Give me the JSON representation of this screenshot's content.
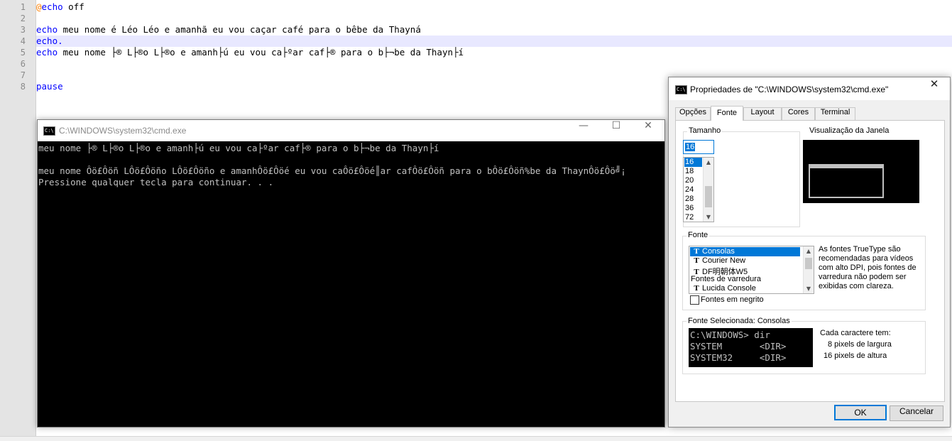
{
  "editor": {
    "line_numbers": [
      "1",
      "2",
      "3",
      "4",
      "5",
      "6",
      "7",
      "8"
    ],
    "line1": {
      "at": "@",
      "kw": "echo",
      "rest": " off"
    },
    "line3": {
      "kw": "echo",
      "rest": " meu nome é Léo Léo e amanhã eu vou caçar café para o bêbe da Thayná"
    },
    "line4": {
      "kw": "echo."
    },
    "line5": {
      "kw": "echo",
      "rest": " meu nome ├® L├®o L├®o e amanh├ú eu vou ca├ºar caf├® para o b├¬be da Thayn├í"
    },
    "line8": {
      "kw": "pause"
    },
    "colors": {
      "keyword": "#0000ff",
      "operator": "#ff8000",
      "current_line": "#e8e8ff"
    }
  },
  "cmd_window": {
    "title": "C:\\WINDOWS\\system32\\cmd.exe",
    "icon_text": "C:\\",
    "buttons": {
      "minimize": "—",
      "maximize": "☐",
      "close": "✕"
    },
    "output": [
      "meu nome ├® L├®o L├®o e amanh├ú eu vou ca├ºar caf├® para o b├¬be da Thayn├í",
      "",
      "meu nome Ôö£Ôöñ LÔö£Ôöño LÔö£Ôöño e amanhÔö£Ôöé eu vou caÔö£Ôöé║ar cafÔö£Ôöñ para o bÔö£Ôöñ%be da ThaynÔö£Ôö╝¡",
      "Pressione qualquer tecla para continuar. . ."
    ]
  },
  "dialog": {
    "title": "Propriedades de \"C:\\WINDOWS\\system32\\cmd.exe\"",
    "icon_text": "C:\\",
    "close": "✕",
    "tabs": [
      "Opções",
      "Fonte",
      "Layout",
      "Cores",
      "Terminal"
    ],
    "active_tab": "Fonte",
    "size_group_label": "Tamanho",
    "size_value": "16",
    "sizes": [
      "16",
      "18",
      "20",
      "24",
      "28",
      "36",
      "72"
    ],
    "selected_size": "16",
    "preview_label": "Visualização da Janela",
    "font_group_label": "Fonte",
    "fonts": [
      {
        "name": "Consolas",
        "icon": "truetype-icon",
        "glyph": "T"
      },
      {
        "name": "Courier New",
        "icon": "truetype-icon",
        "glyph": "T"
      },
      {
        "name": "DF明朝体W5",
        "icon": "truetype-icon",
        "glyph": "T"
      },
      {
        "name": "Fontes de varredura",
        "icon": "",
        "glyph": ""
      },
      {
        "name": "Lucida Console",
        "icon": "truetype-icon",
        "glyph": "T"
      }
    ],
    "selected_font": "Consolas",
    "font_note": "As fontes TrueType são\nrecomendadas para vídeos\ncom alto DPI, pois fontes de\nvarredura não podem ser\nexibidas com clareza.",
    "bold_label": "Fontes em negrito",
    "bold_checked": false,
    "selected_group_label": "Fonte Selecionada: Consolas",
    "font_preview_lines": [
      "C:\\WINDOWS> dir",
      "SYSTEM       <DIR>",
      "SYSTEM32     <DIR>"
    ],
    "char_info_title": "Cada caractere tem:",
    "char_width": "8 pixels de largura",
    "char_height": "16 pixels de altura",
    "ok_label": "OK",
    "cancel_label": "Cancelar",
    "accent": "#0078d7"
  }
}
